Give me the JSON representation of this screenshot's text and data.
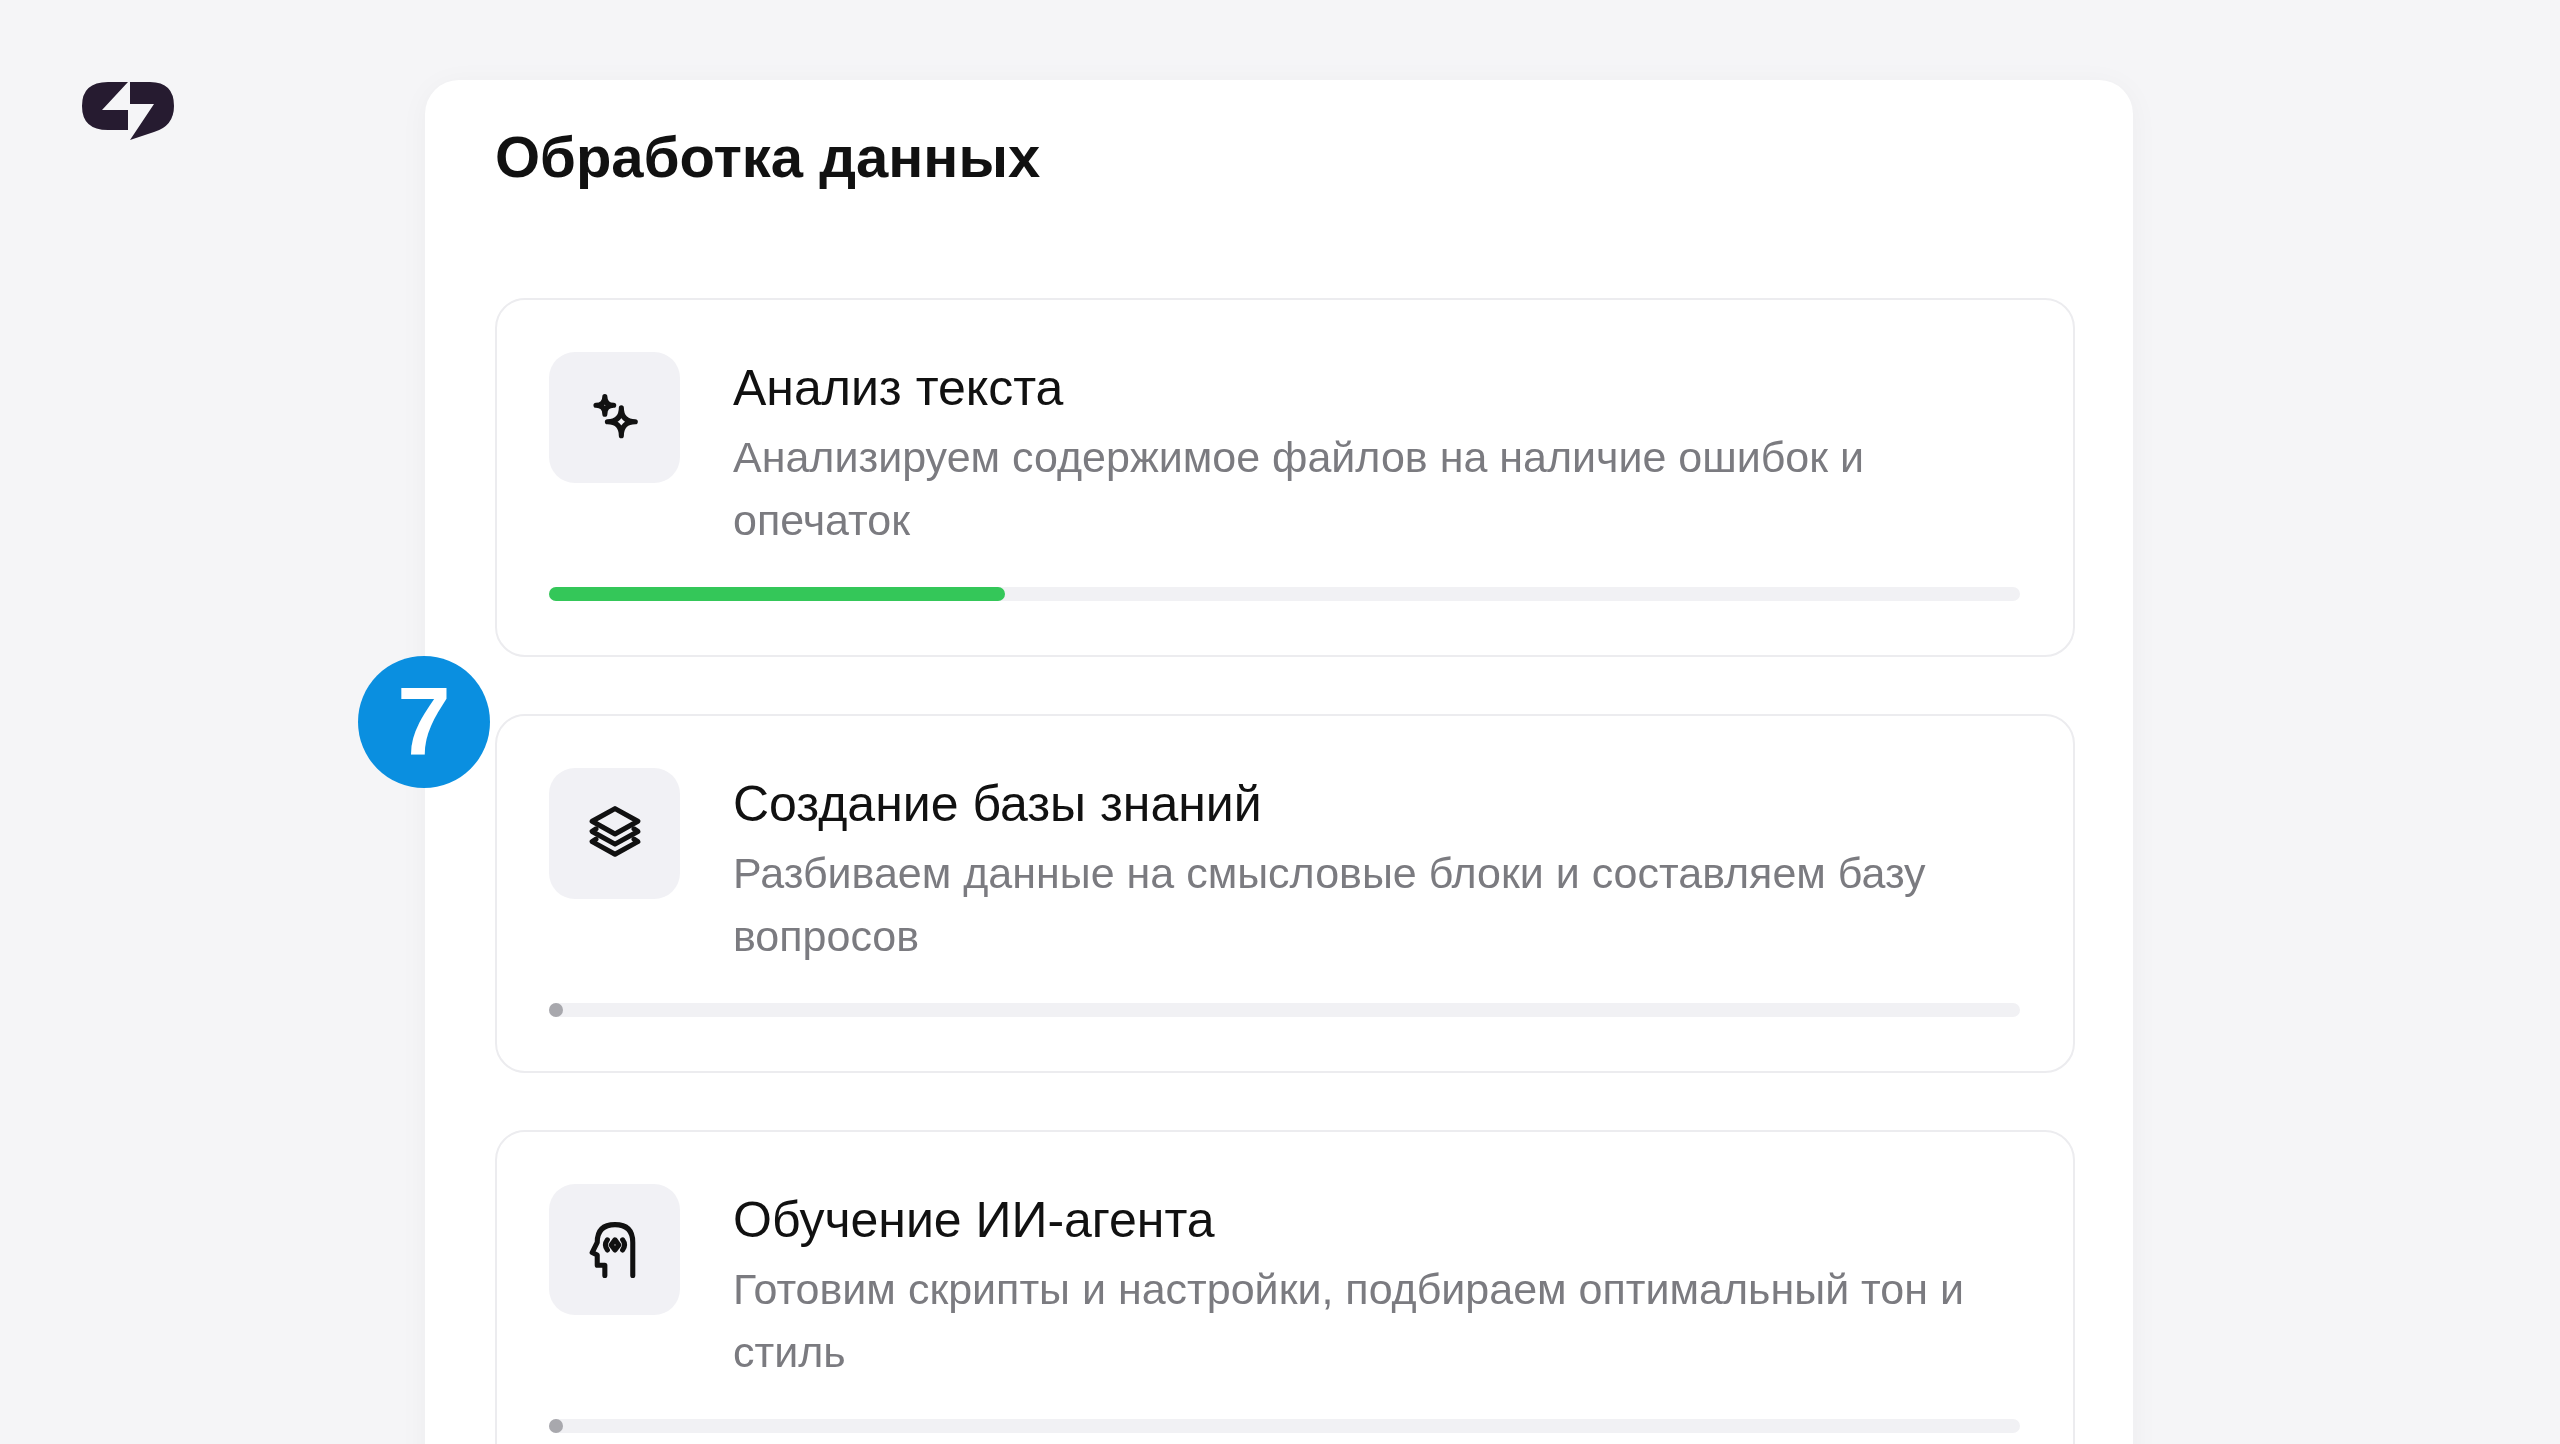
{
  "panel": {
    "title": "Обработка данных"
  },
  "step_badge": "7",
  "steps": [
    {
      "kind": "sparkles",
      "title": "Анализ текста",
      "description": "Анализируем содержимое файлов на наличие ошибок и опечаток",
      "level": 0.31
    },
    {
      "kind": "layers",
      "title": "Создание базы знаний",
      "description": "Разбиваем данные на смысловые блоки и составляем базу вопросов",
      "level": 0
    },
    {
      "kind": "head",
      "title": "Обучение ИИ-агента",
      "description": "Готовим скрипты и настройки, подбираем оптимальный тон и стиль",
      "level": 0
    }
  ]
}
